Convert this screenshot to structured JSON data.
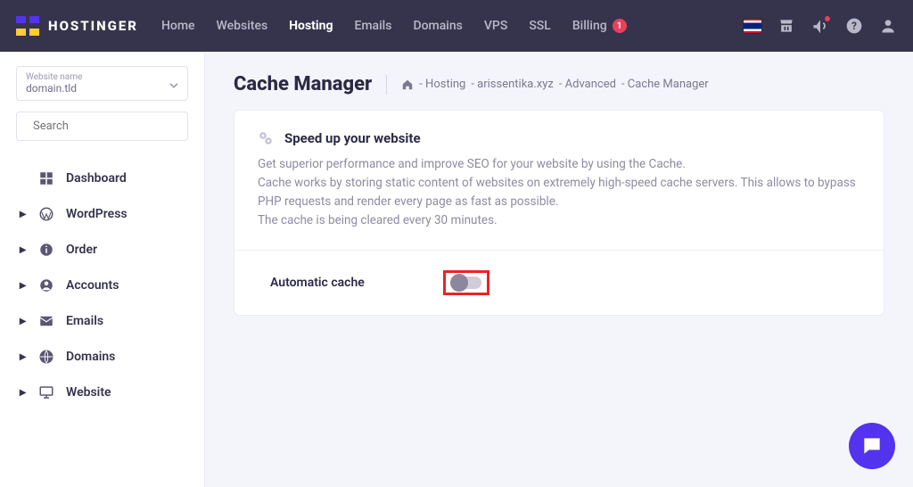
{
  "brand": "HOSTINGER",
  "nav": {
    "home": "Home",
    "websites": "Websites",
    "hosting": "Hosting",
    "emails": "Emails",
    "domains": "Domains",
    "vps": "VPS",
    "ssl": "SSL",
    "billing": "Billing",
    "billing_badge": "1"
  },
  "sidebar": {
    "select_label": "Website name",
    "select_value": "domain.tld",
    "search_placeholder": "Search",
    "items": {
      "dashboard": "Dashboard",
      "wordpress": "WordPress",
      "order": "Order",
      "accounts": "Accounts",
      "emails": "Emails",
      "domains": "Domains",
      "website": "Website"
    }
  },
  "page": {
    "title": "Cache Manager",
    "crumbs": {
      "a": "- Hosting",
      "b": "- arissentika.xyz",
      "c": "- Advanced",
      "d": "- Cache Manager"
    }
  },
  "card": {
    "title": "Speed up your website",
    "p1": "Get superior performance and improve SEO for your website by using the Cache.",
    "p2": "Cache works by storing static content of websites on extremely high-speed cache servers. This allows to bypass PHP requests and render every page as fast as possible.",
    "p3": "The cache is being cleared every 30 minutes.",
    "toggle_label": "Automatic cache"
  }
}
